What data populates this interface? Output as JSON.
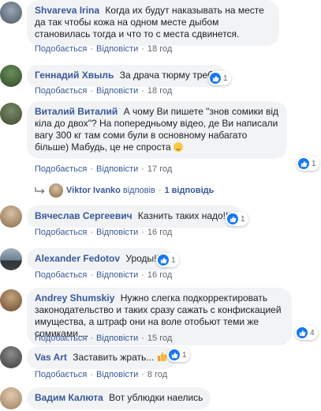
{
  "actions": {
    "like": "Подобається",
    "reply": "Відповісти",
    "dot": "·"
  },
  "comments": [
    {
      "author": "Shvareva Irina",
      "text": "Когда их будут наказывать на месте да так чтобы кожа на одном месте дыбом становилась тогда и что то с места сдвинется.",
      "time": "18 год"
    },
    {
      "author": "Геннадий Хвыль",
      "text": "За драча тюрму треба",
      "time": "18 год",
      "reactions": "1"
    },
    {
      "author": "Виталий Виталий",
      "text": "А чому Ви пишете \"знов сомики від кіла до двох\"? На попередньому відео, де Ви написали вагу 300 кг там соми були в основному набагато більше) Мабудь, це не спроста",
      "time": "17 год",
      "reactions": "1",
      "reply_summary": {
        "replier": "Viktor Ivanko",
        "replied": "відповів",
        "count": "1 відповідь"
      }
    },
    {
      "author": "Вячеслав Сергеевич",
      "text": "Казнить таких надо!!!!",
      "time": "16 год",
      "reactions": "1"
    },
    {
      "author": "Alexander Fedotov",
      "text": "Уроды!!!!",
      "time": "16 год",
      "reactions": "1"
    },
    {
      "author": "Andrey Shumskiy",
      "text": "Нужно слегка подкорректировать законодательство и таких сразу сажать с конфискацией имущества, а штраф они на воле отобьют теми же сомиками....",
      "time": "15 год",
      "reactions": "4"
    },
    {
      "author": "Vas Art",
      "text": "Заставить жрать...",
      "time": "8 год",
      "reactions": "1"
    },
    {
      "author": "Вадим Калюта",
      "text": "Вот ублюдки наелись"
    }
  ],
  "colors": {
    "link": "#385898",
    "bubble": "#f2f3f5",
    "like": "#1877f2",
    "muted": "#606770"
  }
}
